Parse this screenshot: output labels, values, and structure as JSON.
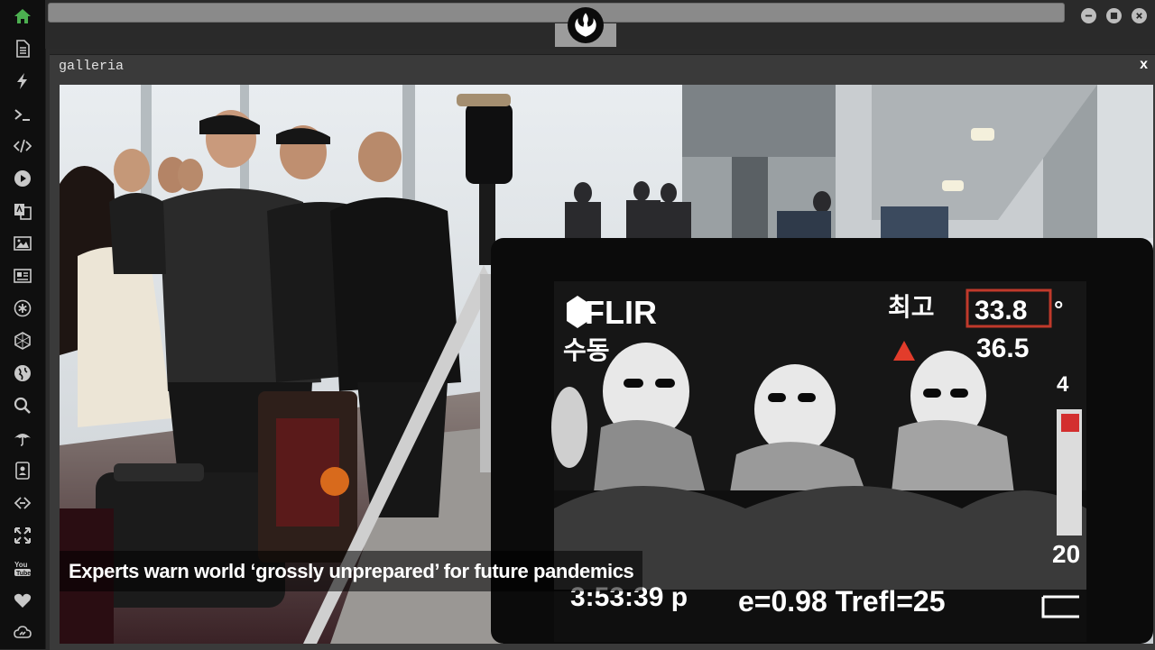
{
  "sidebar": {
    "items": [
      {
        "name": "home-icon",
        "active": true
      },
      {
        "name": "document-icon"
      },
      {
        "name": "lightning-icon"
      },
      {
        "name": "terminal-icon"
      },
      {
        "name": "code-icon"
      },
      {
        "name": "play-circle-icon"
      },
      {
        "name": "translate-icon"
      },
      {
        "name": "image-icon"
      },
      {
        "name": "newspaper-icon"
      },
      {
        "name": "asterisk-circle-icon"
      },
      {
        "name": "hexagon-icon"
      },
      {
        "name": "globe-icon"
      },
      {
        "name": "search-icon"
      },
      {
        "name": "umbrella-icon"
      },
      {
        "name": "contact-card-icon"
      },
      {
        "name": "code-diamond-icon"
      },
      {
        "name": "expand-arrows-icon"
      },
      {
        "name": "youtube-icon"
      },
      {
        "name": "heart-icon"
      },
      {
        "name": "cloud-link-icon"
      }
    ],
    "accent": "#4caf50",
    "icon_color": "#c8c8c8"
  },
  "topbar": {
    "logo_icon": "rebel-alliance-icon",
    "controls": [
      "minimize-icon",
      "maximize-icon",
      "close-icon"
    ]
  },
  "window": {
    "title": "galleria",
    "close_label": "x"
  },
  "gallery": {
    "caption": "Experts warn world ‘grossly unprepared’ for future pandemics",
    "photo": {
      "brand": "FLIR",
      "label_max": "최고",
      "label_manual": "수동",
      "temp_max": "33.8",
      "temp_unit": "°",
      "temp_second": "36.5",
      "bottom_time": "3:53:39 p",
      "bottom_params": "e=0.98 Trefl=25",
      "scale_top": "4",
      "scale_bottom": "20"
    }
  }
}
